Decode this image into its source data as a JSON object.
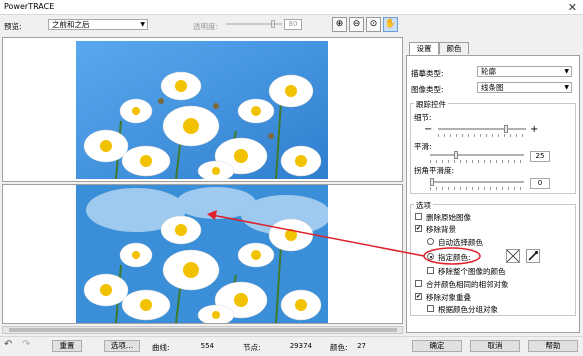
{
  "window": {
    "title": "PowerTRACE"
  },
  "toolbar": {
    "preview_label": "预览:",
    "preview_value": "之前和之后",
    "transparency_label": "透明度:",
    "transparency_value": "80"
  },
  "tabs": [
    "设置",
    "颜色"
  ],
  "settings": {
    "trace_type_label": "描摹类型:",
    "trace_type_value": "轮廓",
    "image_type_label": "图像类型:",
    "image_type_value": "线条图",
    "trace_controls_title": "跟踪控件",
    "detail_label": "细节:",
    "smoothing_label": "平滑:",
    "smoothing_value": "25",
    "corner_smoothness_label": "拐角平滑度:",
    "corner_smoothness_value": "0",
    "options_title": "选项",
    "options": {
      "delete_original": "删除原始图像",
      "remove_background": "移除背景",
      "auto_select_color": "自动选择颜色",
      "specify_color": "指定颜色:",
      "remove_entire_image_color": "移除整个图像的颜色",
      "merge_adjacent": "合并颜色相同的相邻对象",
      "remove_overlap": "移除对象重叠",
      "group_by_color": "根据颜色分组对象"
    }
  },
  "bottom": {
    "reset_label": "重置",
    "options_label": "选项...",
    "curves_label": "曲线:",
    "curves_value": "554",
    "nodes_label": "节点:",
    "nodes_value": "29374",
    "colors_label": "颜色:",
    "colors_value": "27",
    "ok_label": "确定",
    "cancel_label": "取消",
    "help_label": "帮助"
  },
  "colors": {
    "accent_red": "#e0202a",
    "sky": "#3a8fd8",
    "selection_blue": "#cce0f5"
  }
}
